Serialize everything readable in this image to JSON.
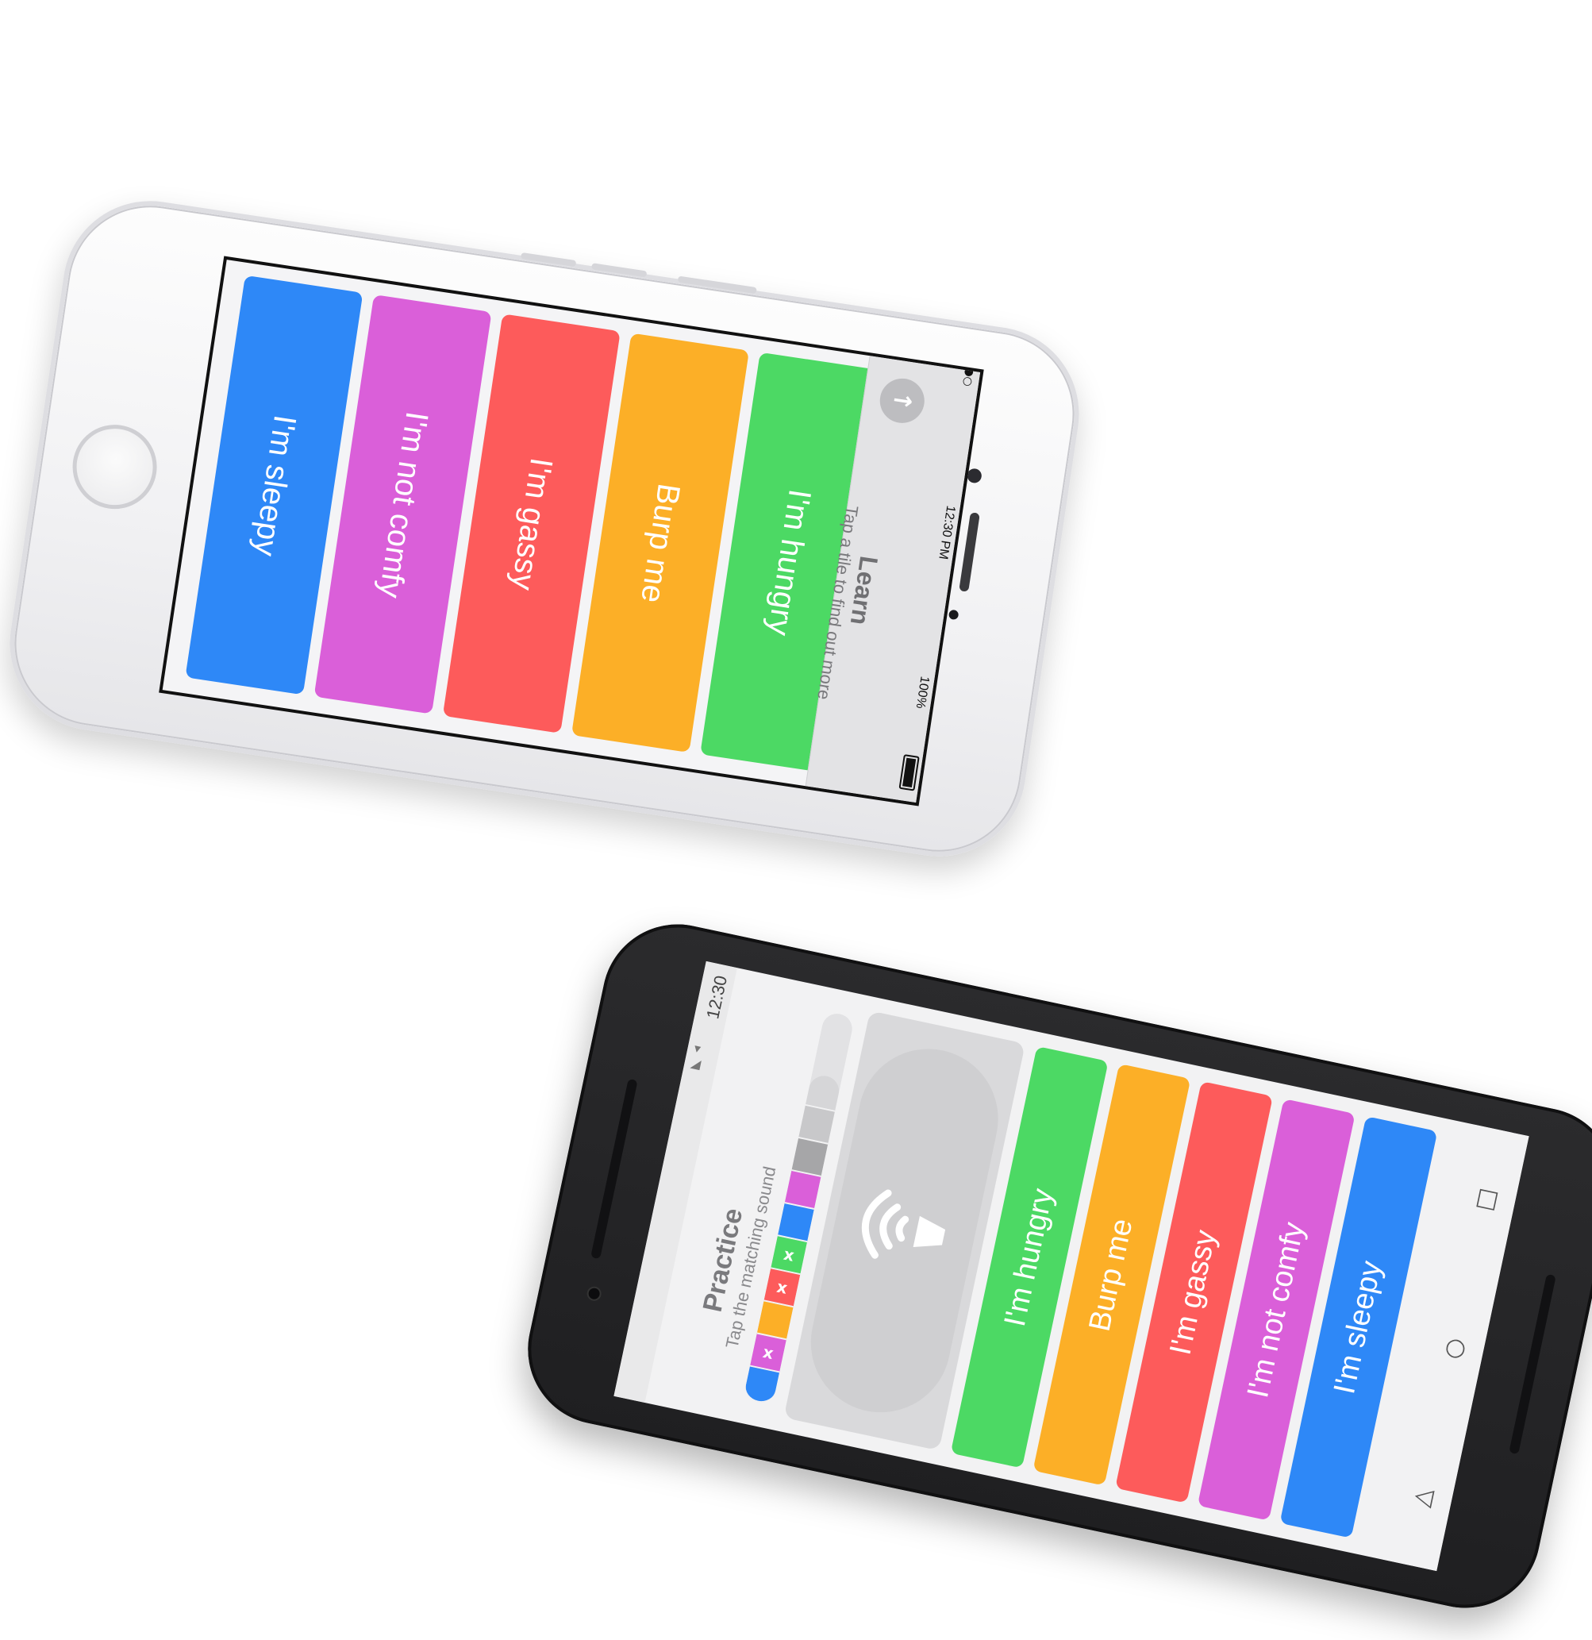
{
  "colors": {
    "blue": "#2E88F7",
    "purple": "#DA5FD9",
    "red": "#FD5B5B",
    "orange": "#FCAF27",
    "green": "#4CD964"
  },
  "ios": {
    "status": {
      "time": "12:30 PM",
      "battery": "100%"
    },
    "learn": {
      "title": "Learn",
      "subtitle": "Tap a tile to find out more",
      "back_icon": "arrow-up-icon"
    },
    "tiles": [
      {
        "label": "I'm sleepy",
        "color": "#2E88F7"
      },
      {
        "label": "I'm not comfy",
        "color": "#DA5FD9"
      },
      {
        "label": "I'm gassy",
        "color": "#FD5B5B"
      },
      {
        "label": "Burp me",
        "color": "#FCAF27"
      },
      {
        "label": "I'm hungry",
        "color": "#4CD964"
      }
    ]
  },
  "android": {
    "status": {
      "time": "12:30"
    },
    "practice": {
      "title": "Practice",
      "subtitle": "Tap the matching sound",
      "sound_icon": "speaker-icon"
    },
    "progress": [
      {
        "color": "#2E88F7",
        "mark": ""
      },
      {
        "color": "#DA5FD9",
        "mark": "x"
      },
      {
        "color": "#FCAF27",
        "mark": ""
      },
      {
        "color": "#FD5B5B",
        "mark": "x"
      },
      {
        "color": "#4CD964",
        "mark": "x"
      },
      {
        "color": "#2E88F7",
        "mark": ""
      },
      {
        "color": "#DA5FD9",
        "mark": ""
      },
      {
        "color": "#A6A6A8",
        "mark": ""
      },
      {
        "color": "#C8C8CA",
        "mark": ""
      },
      {
        "color": "#D6D6D8",
        "mark": ""
      }
    ],
    "tiles": [
      {
        "label": "I'm hungry",
        "color": "#4CD964"
      },
      {
        "label": "Burp me",
        "color": "#FCAF27"
      },
      {
        "label": "I'm gassy",
        "color": "#FD5B5B"
      },
      {
        "label": "I'm not comfy",
        "color": "#DA5FD9"
      },
      {
        "label": "I'm sleepy",
        "color": "#2E88F7"
      }
    ],
    "nav": [
      "recents-icon",
      "home-icon",
      "back-icon"
    ]
  }
}
